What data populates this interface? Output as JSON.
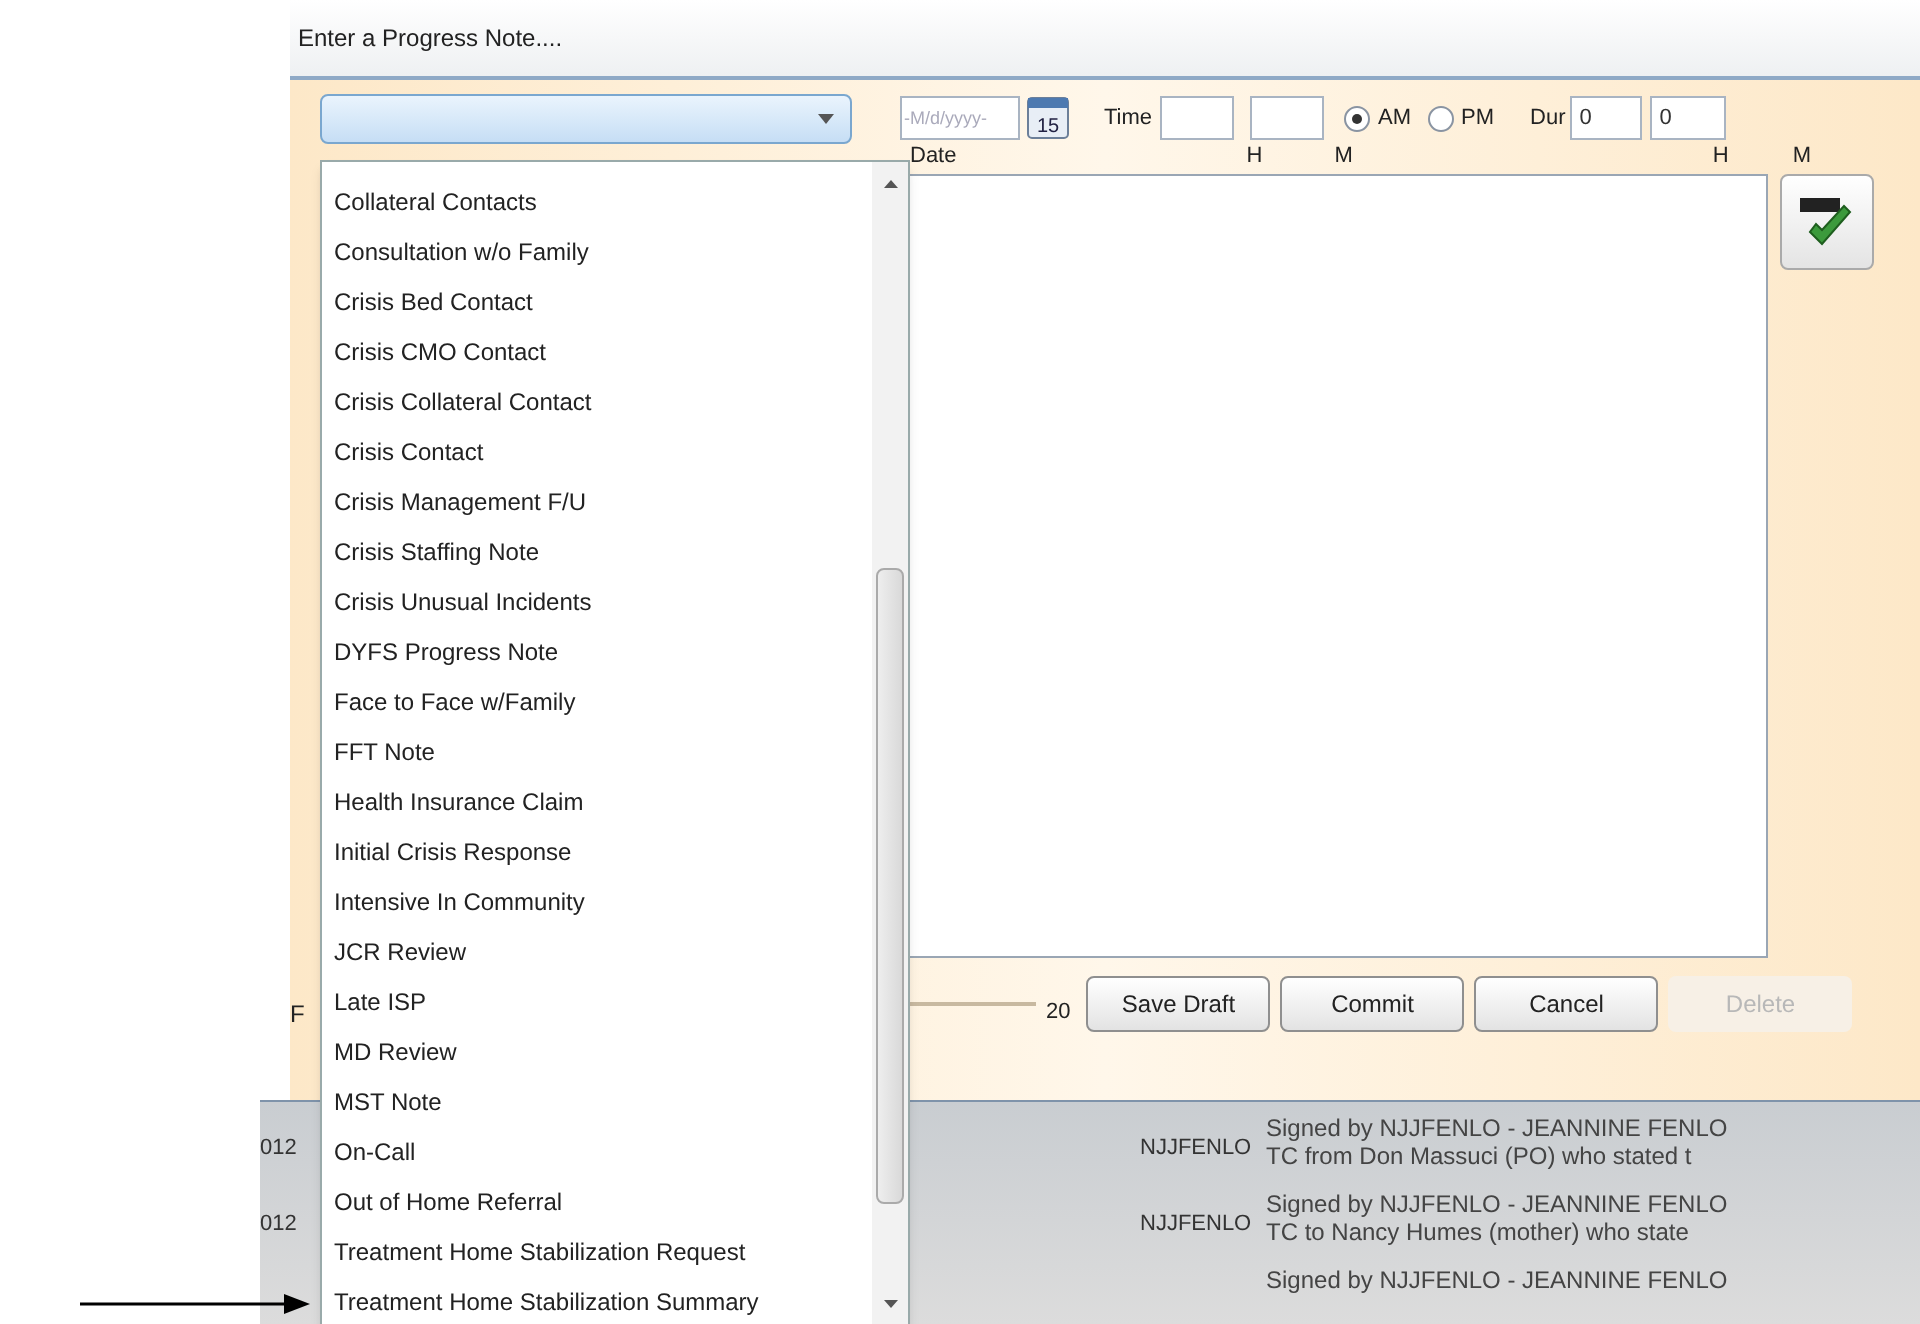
{
  "window": {
    "title": "Enter a Progress Note...."
  },
  "note_type": {
    "expanded": true,
    "options": [
      {
        "label": "Collateral Contacts",
        "selected": false
      },
      {
        "label": "Consultation w/o Family",
        "selected": false
      },
      {
        "label": "Crisis Bed Contact",
        "selected": false
      },
      {
        "label": "Crisis CMO Contact",
        "selected": false
      },
      {
        "label": "Crisis Collateral Contact",
        "selected": false
      },
      {
        "label": "Crisis Contact",
        "selected": false
      },
      {
        "label": "Crisis Management F/U",
        "selected": false
      },
      {
        "label": "Crisis Staffing Note",
        "selected": false
      },
      {
        "label": "Crisis Unusual Incidents",
        "selected": false
      },
      {
        "label": "DYFS Progress Note",
        "selected": false
      },
      {
        "label": "Face to Face w/Family",
        "selected": false
      },
      {
        "label": "FFT Note",
        "selected": false
      },
      {
        "label": "Health Insurance Claim",
        "selected": false
      },
      {
        "label": "Initial Crisis Response",
        "selected": false
      },
      {
        "label": "Intensive In Community",
        "selected": false
      },
      {
        "label": "JCR Review",
        "selected": false
      },
      {
        "label": "Late ISP",
        "selected": false
      },
      {
        "label": "MD Review",
        "selected": false
      },
      {
        "label": "MST Note",
        "selected": false
      },
      {
        "label": "On-Call",
        "selected": false
      },
      {
        "label": "Out of Home Referral",
        "selected": false
      },
      {
        "label": "Treatment Home Stabilization Request",
        "selected": false
      },
      {
        "label": "Treatment Home Stabilization Summary",
        "selected": false
      }
    ]
  },
  "date": {
    "placeholder": "-M/d/yyyy-",
    "label": "Date",
    "calendar_day": "15"
  },
  "time": {
    "label": "Time",
    "hour_label": "H",
    "minute_label": "M",
    "periods": [
      {
        "label": "AM",
        "selected": true
      },
      {
        "label": "PM",
        "selected": false
      }
    ]
  },
  "duration": {
    "label": "Dur",
    "hours": "0",
    "minutes": "0",
    "hour_label": "H",
    "minute_label": "M"
  },
  "footer": {
    "side_label": "F",
    "counter": "20",
    "buttons": [
      {
        "label": "Save Draft",
        "disabled": false
      },
      {
        "label": "Commit",
        "disabled": false
      },
      {
        "label": "Cancel",
        "disabled": false
      },
      {
        "label": "Delete",
        "disabled": true
      }
    ]
  },
  "history": {
    "rows": [
      {
        "date": "012",
        "user": "NJJFENLO",
        "lines": [
          "Signed by NJJFENLO - JEANNINE FENLO",
          "TC from Don Massuci (PO) who stated t"
        ]
      },
      {
        "date": "012",
        "user": "NJJFENLO",
        "lines": [
          "Signed by NJJFENLO - JEANNINE FENLO",
          "TC to Nancy Humes (mother) who state"
        ]
      },
      {
        "lines": [
          "Signed by NJJFENLO - JEANNINE FENLO"
        ]
      }
    ]
  }
}
